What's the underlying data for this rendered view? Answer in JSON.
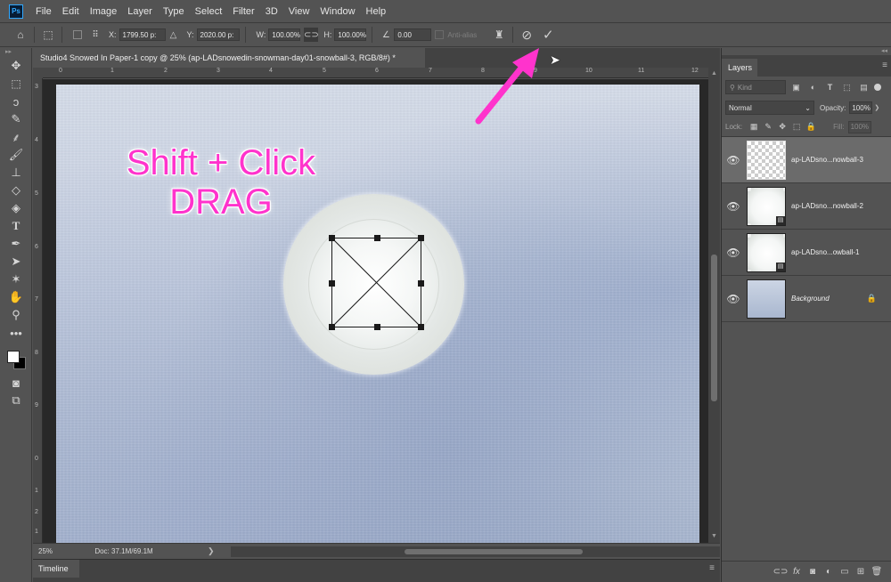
{
  "app": {
    "logo": "Ps"
  },
  "menubar": {
    "items": [
      "File",
      "Edit",
      "Image",
      "Layer",
      "Type",
      "Select",
      "Filter",
      "3D",
      "View",
      "Window",
      "Help"
    ]
  },
  "options": {
    "x_label": "X:",
    "x_value": "1799.50 p:",
    "y_value": "2020.00 p:",
    "w_label": "W:",
    "w_value": "100.00%",
    "h_label": "H:",
    "h_value": "100.00%",
    "angle_value": "0.00",
    "antialias_label": "Anti-alias",
    "icons": [
      "home-icon",
      "reference-point-icon",
      "delta-y-icon",
      "link-icon",
      "angle-icon",
      "warp-icon",
      "cancel-icon",
      "commit-icon"
    ]
  },
  "document": {
    "tab_title": "Studio4 Snowed In Paper-1 copy @ 25% (ap-LADsnowedin-snowman-day01-snowball-3, RGB/8#) *",
    "annotation_line1": "Shift + Click",
    "annotation_line2": "DRAG",
    "annotation_color": "#ff33cc",
    "ruler_h_numbers": [
      "0",
      "1",
      "2",
      "3",
      "4",
      "5",
      "6",
      "7",
      "8",
      "9",
      "10",
      "11",
      "12"
    ],
    "ruler_v_numbers": [
      "3",
      "4",
      "5",
      "6",
      "7",
      "8",
      "9",
      "0",
      "1",
      "2",
      "1"
    ]
  },
  "statusbar": {
    "zoom": "25%",
    "doc_info": "Doc: 37.1M/69.1M",
    "arrow": "❯"
  },
  "timeline": {
    "tab_label": "Timeline"
  },
  "layers_panel": {
    "tab_label": "Layers",
    "kind_placeholder": "Kind",
    "blend_mode": "Normal",
    "opacity_label": "Opacity:",
    "opacity_value": "100%",
    "lock_label": "Lock:",
    "fill_label": "Fill:",
    "fill_value": "100%",
    "layers": [
      {
        "name": "ap-LADsno...nowball-3",
        "selected": true
      },
      {
        "name": "ap-LADsno...nowball-2",
        "selected": false
      },
      {
        "name": "ap-LADsno...owball-1",
        "selected": false
      },
      {
        "name": "Background",
        "selected": false
      }
    ]
  },
  "colors": {
    "ui_bg": "#535353",
    "ui_dark": "#424242",
    "annotation": "#ff33cc",
    "selected_layer": "#6b6b6b"
  }
}
